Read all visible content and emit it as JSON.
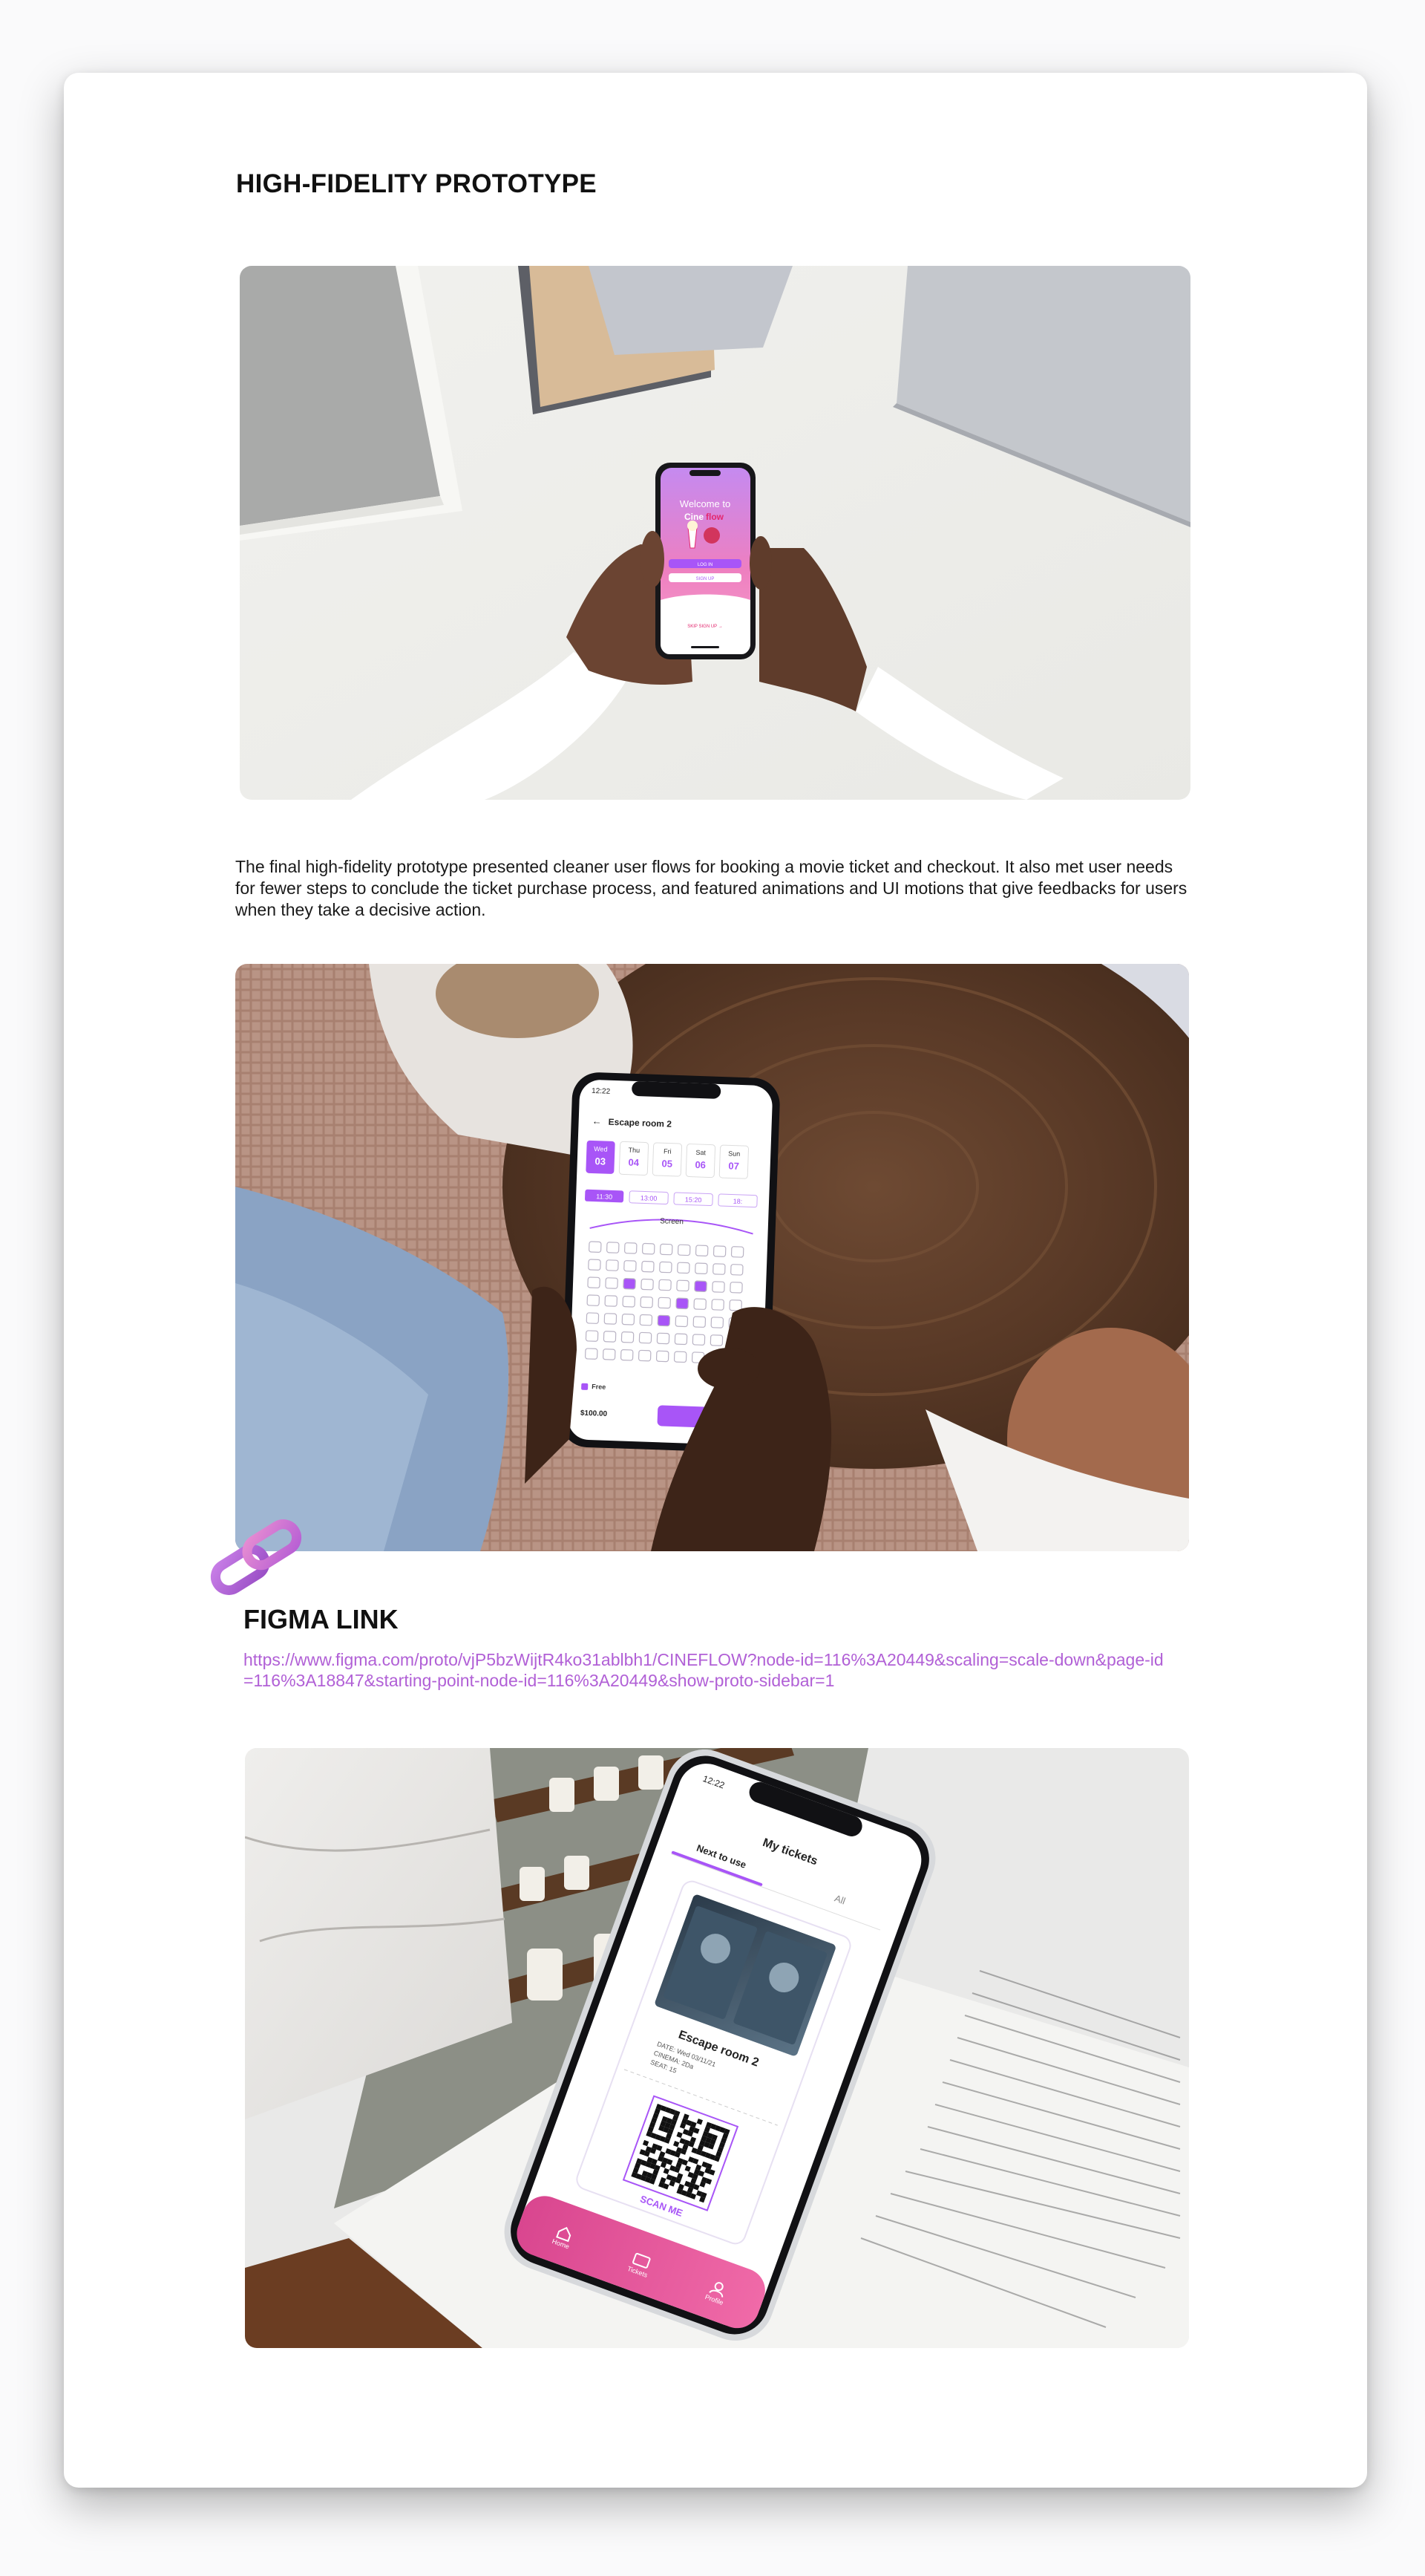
{
  "section": {
    "title": "HIGH-FIDELITY PROTOTYPE",
    "description": "The final high-fidelity prototype presented cleaner user flows for booking a movie ticket and checkout. It also met user needs for fewer steps to conclude the ticket purchase process, and featured animations and UI motions that give feedbacks for users when they take a decisive action."
  },
  "mockup1": {
    "welcome": "Welcome to",
    "brand_a": "Cine",
    "brand_b": "flow",
    "login": "LOG IN",
    "signup": "SIGN UP",
    "skip": "SKIP SIGN UP →"
  },
  "mockup2": {
    "time": "12:22",
    "room": "Escape room 2",
    "days": [
      {
        "d": "Wed",
        "n": "03"
      },
      {
        "d": "Thu",
        "n": "04"
      },
      {
        "d": "Fri",
        "n": "05"
      },
      {
        "d": "Sat",
        "n": "06"
      },
      {
        "d": "Sun",
        "n": "07"
      }
    ],
    "times": [
      "11:30",
      "13:00",
      "15:20",
      "18:"
    ],
    "screen": "Screen",
    "legend_free": "Free",
    "price": "$100.00"
  },
  "figma": {
    "title": "FIGMA LINK",
    "url": "https://www.figma.com/proto/vjP5bzWijtR4ko31ablbh1/CINEFLOW?node-id=116%3A20449&scaling=scale-down&page-id=116%3A18847&starting-point-node-id=116%3A20449&show-proto-sidebar=1"
  },
  "mockup3": {
    "time": "12:22",
    "header": "My tickets",
    "tab_active": "Next to use",
    "tab_other": "All",
    "movie": "Escape room 2",
    "date_line": "DATE: Wed 03/11/21",
    "cinema_line": "CINEMA: 2Da",
    "seat_line": "SEAT: 15",
    "scan": "SCAN ME",
    "nav": [
      "Home",
      "Tickets",
      "Profile"
    ]
  },
  "colors": {
    "accent_purple": "#a855f7",
    "accent_pink": "#ec4899",
    "link": "#b160d6"
  }
}
